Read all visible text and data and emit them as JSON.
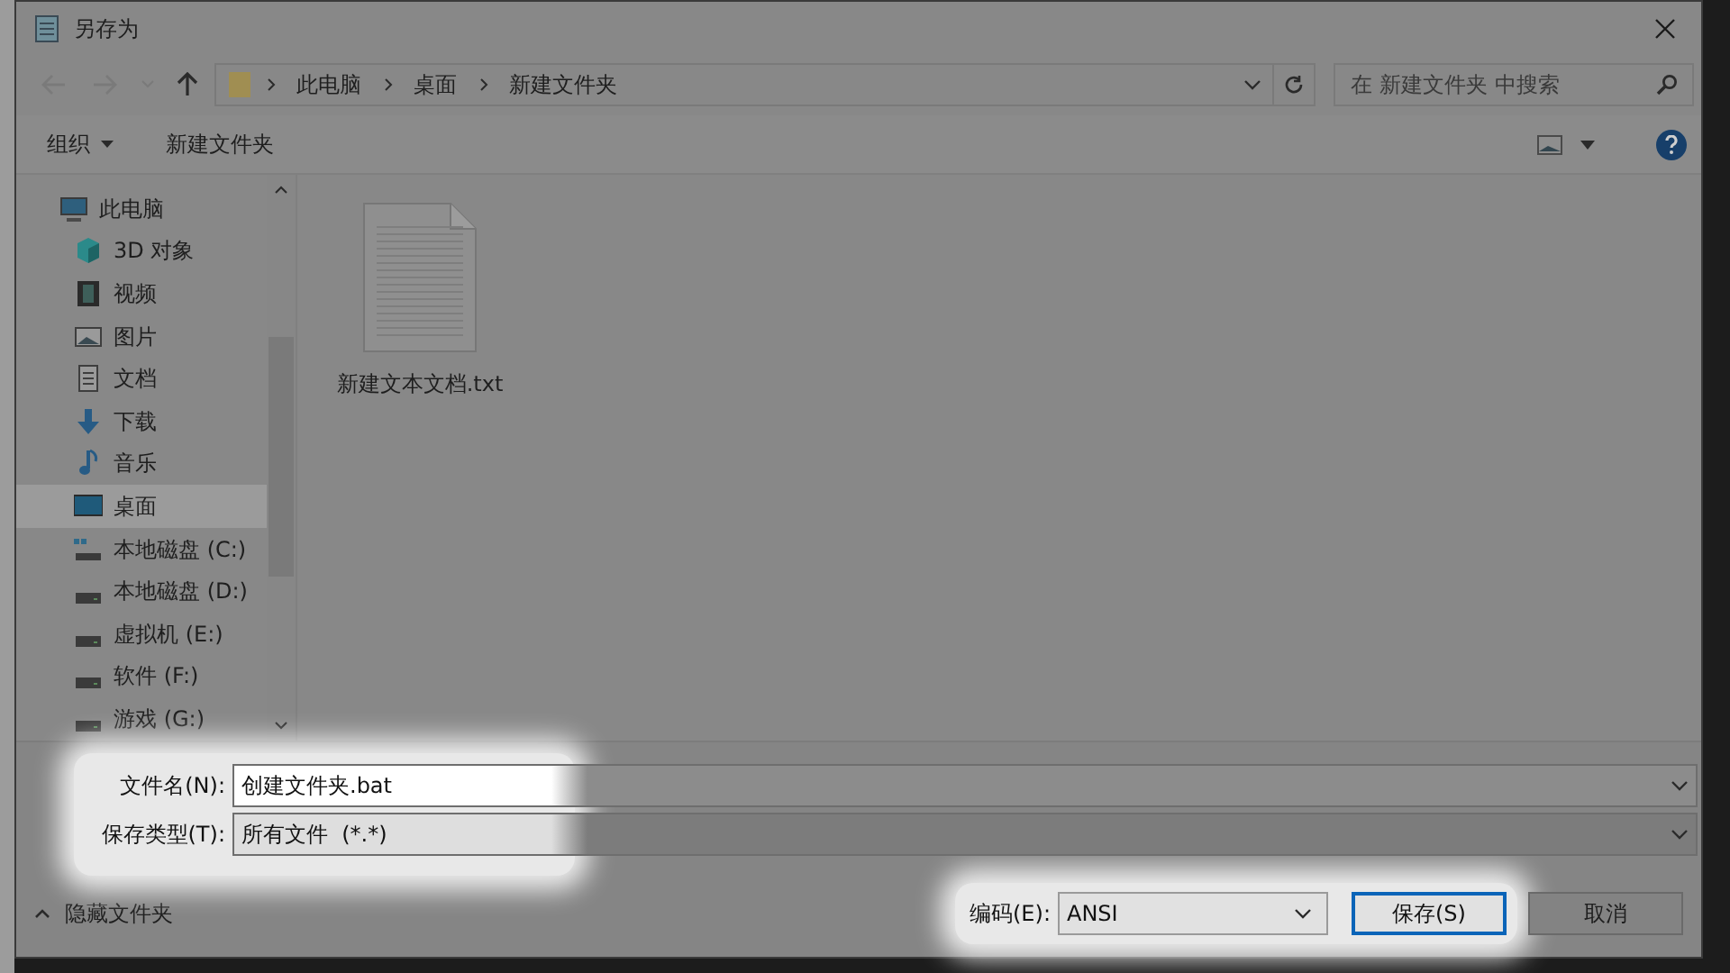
{
  "window": {
    "title": "另存为"
  },
  "address": {
    "crumbs": [
      "此电脑",
      "桌面",
      "新建文件夹"
    ]
  },
  "search": {
    "placeholder": "在 新建文件夹 中搜索"
  },
  "toolbar": {
    "organize": "组织",
    "new_folder": "新建文件夹"
  },
  "sidebar": {
    "items": [
      {
        "label": "此电脑",
        "kind": "pc",
        "selected": false,
        "children": [
          {
            "label": "3D 对象",
            "kind": "cube",
            "selected": false
          },
          {
            "label": "视频",
            "kind": "video",
            "selected": false
          },
          {
            "label": "图片",
            "kind": "pictures",
            "selected": false
          },
          {
            "label": "文档",
            "kind": "docs",
            "selected": false
          },
          {
            "label": "下载",
            "kind": "download",
            "selected": false
          },
          {
            "label": "音乐",
            "kind": "music",
            "selected": false
          },
          {
            "label": "桌面",
            "kind": "desktop",
            "selected": true
          },
          {
            "label": "本地磁盘 (C:)",
            "kind": "system-drive",
            "selected": false
          },
          {
            "label": "本地磁盘 (D:)",
            "kind": "drive",
            "selected": false
          },
          {
            "label": "虚拟机 (E:)",
            "kind": "drive",
            "selected": false
          },
          {
            "label": "软件 (F:)",
            "kind": "drive",
            "selected": false
          },
          {
            "label": "游戏 (G:)",
            "kind": "drive",
            "selected": false
          }
        ]
      }
    ]
  },
  "files": [
    {
      "name": "新建文本文档.txt"
    }
  ],
  "form": {
    "filename_label": "文件名(N):",
    "filename": "创建文件夹.bat",
    "type_label": "保存类型(T):",
    "type": "所有文件  (*.*)"
  },
  "footer": {
    "hide_folders": "隐藏文件夹",
    "encoding_label": "编码(E):",
    "encoding": "ANSI",
    "save": "保存(S)",
    "cancel": "取消"
  }
}
